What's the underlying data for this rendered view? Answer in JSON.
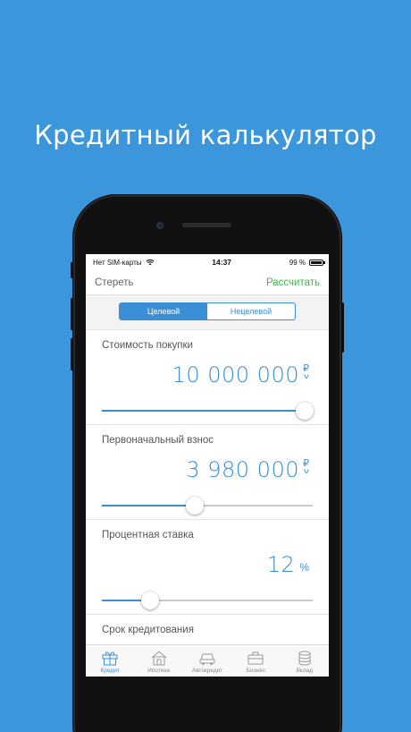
{
  "headline": "Кредитный калькулятор",
  "status": {
    "carrier": "Нет SIM-карты",
    "time": "14:37",
    "battery": "99 %",
    "battery_level": 0.99
  },
  "navbar": {
    "clear_label": "Стереть",
    "calc_label": "Рассчитать"
  },
  "segmented": {
    "options": [
      "Целевой",
      "Нецелевой"
    ],
    "selected": "Целевой"
  },
  "fields": [
    {
      "label": "Стоимость покупки",
      "value": "10 000 000",
      "unit": "₽",
      "slider_fraction": 0.96
    },
    {
      "label": "Первоначальный взнос",
      "value": "3 980 000",
      "unit": "₽",
      "slider_fraction": 0.44
    },
    {
      "label": "Процентная ставка",
      "value": "12",
      "unit": "%",
      "slider_fraction": 0.23
    },
    {
      "label": "Срок кредитования"
    }
  ],
  "tabs": [
    {
      "label": "Кредит",
      "icon": "gift-icon",
      "active": true
    },
    {
      "label": "Ипотека",
      "icon": "house-icon",
      "active": false
    },
    {
      "label": "Автокредит",
      "icon": "car-icon",
      "active": false
    },
    {
      "label": "Бизнес",
      "icon": "briefcase-icon",
      "active": false
    },
    {
      "label": "Вклад",
      "icon": "coins-icon",
      "active": false
    }
  ],
  "colors": {
    "background": "#3b96db",
    "accent": "#3b8fd6",
    "calc": "#3fb554"
  }
}
